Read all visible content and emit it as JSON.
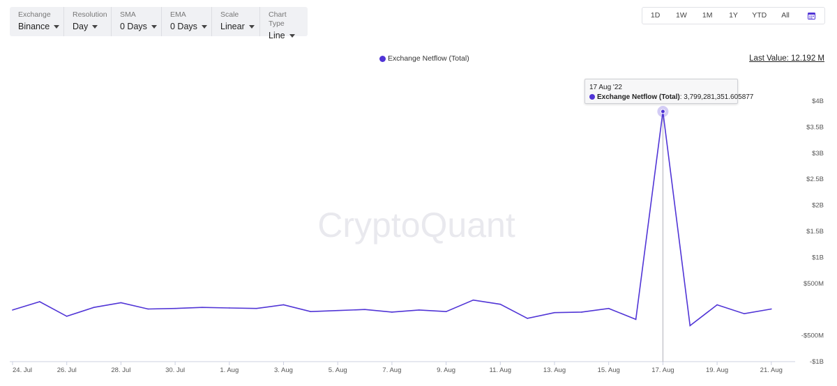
{
  "toolbar": {
    "exchange": {
      "label": "Exchange",
      "value": "Binance"
    },
    "resolution": {
      "label": "Resolution",
      "value": "Day"
    },
    "sma": {
      "label": "SMA",
      "value": "0 Days"
    },
    "ema": {
      "label": "EMA",
      "value": "0 Days"
    },
    "scale": {
      "label": "Scale",
      "value": "Linear"
    },
    "chart_type": {
      "label": "Chart Type",
      "value": "Line"
    }
  },
  "ranges": [
    "1D",
    "1W",
    "1M",
    "1Y",
    "YTD",
    "All"
  ],
  "calendar_icon": "calendar-icon",
  "last_value": "Last Value: 12.192 M",
  "watermark": "CryptoQuant",
  "tooltip": {
    "date": "17 Aug '22",
    "series": "Exchange Netflow (Total)",
    "value": ": 3,799,281,351.605877"
  },
  "colors": {
    "line": "#5034d6",
    "accent": "#5034d6"
  },
  "chart_data": {
    "type": "line",
    "title": "",
    "xlabel": "",
    "ylabel": "",
    "ylim": [
      -1000000000,
      4000000000
    ],
    "y_ticks": [
      4000000000,
      3500000000,
      3000000000,
      2500000000,
      2000000000,
      1500000000,
      1000000000,
      500000000,
      -500000000,
      -1000000000
    ],
    "y_tick_labels": [
      "$4B",
      "$3.5B",
      "$3B",
      "$2.5B",
      "$2B",
      "$1.5B",
      "$1B",
      "$500M",
      "-$500M",
      "-$1B"
    ],
    "x_tick_labels": [
      "24. Jul",
      "26. Jul",
      "28. Jul",
      "30. Jul",
      "1. Aug",
      "3. Aug",
      "5. Aug",
      "7. Aug",
      "9. Aug",
      "11. Aug",
      "13. Aug",
      "15. Aug",
      "17. Aug",
      "19. Aug",
      "21. Aug"
    ],
    "x": [
      "2022-07-24",
      "2022-07-25",
      "2022-07-26",
      "2022-07-27",
      "2022-07-28",
      "2022-07-29",
      "2022-07-30",
      "2022-07-31",
      "2022-08-01",
      "2022-08-02",
      "2022-08-03",
      "2022-08-04",
      "2022-08-05",
      "2022-08-06",
      "2022-08-07",
      "2022-08-08",
      "2022-08-09",
      "2022-08-10",
      "2022-08-11",
      "2022-08-12",
      "2022-08-13",
      "2022-08-14",
      "2022-08-15",
      "2022-08-16",
      "2022-08-17",
      "2022-08-18",
      "2022-08-19",
      "2022-08-20",
      "2022-08-21"
    ],
    "series": [
      {
        "name": "Exchange Netflow (Total)",
        "values": [
          -10000000,
          150000000,
          -130000000,
          40000000,
          130000000,
          10000000,
          20000000,
          40000000,
          30000000,
          20000000,
          90000000,
          -40000000,
          -20000000,
          0,
          -50000000,
          -10000000,
          -40000000,
          180000000,
          100000000,
          -170000000,
          -60000000,
          -50000000,
          20000000,
          -190000000,
          3799281351.605877,
          -310000000,
          90000000,
          -80000000,
          10000000
        ]
      }
    ],
    "highlight_index": 24,
    "legend_position": "top-center",
    "grid": false
  }
}
